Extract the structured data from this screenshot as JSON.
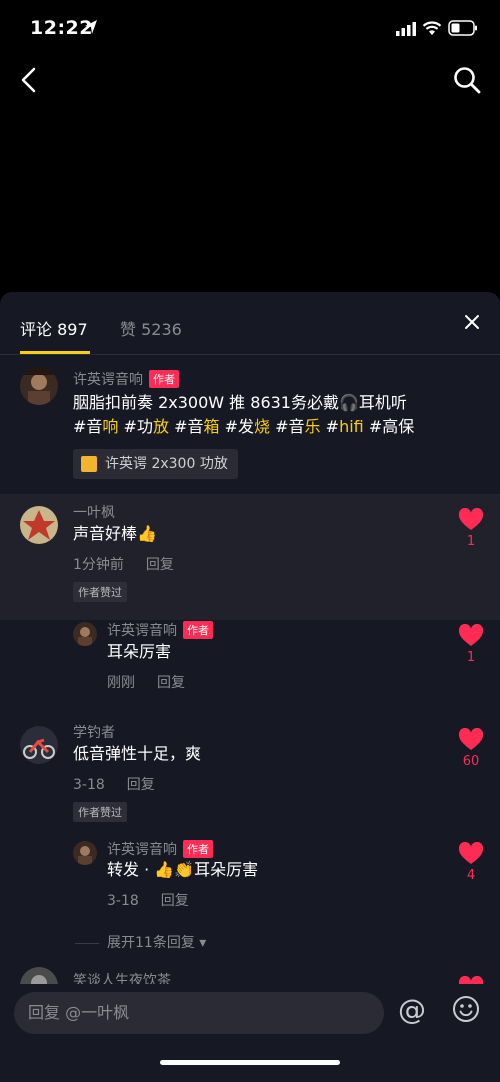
{
  "status_bar": {
    "time": "12:22"
  },
  "tabs": {
    "comments": "评论 897",
    "likes": "赞 5236"
  },
  "pinned": {
    "username": "许英谔音响",
    "author_tag": "作者",
    "text_line1": "胭脂扣前奏 2x300W 推 8631务必戴🎧耳机听",
    "tags": [
      {
        "pre": "#音",
        "hl": "响"
      },
      {
        "pre": "#功",
        "hl": "放"
      },
      {
        "pre": "#音",
        "hl": "箱"
      },
      {
        "pre": "#发",
        "hl": "烧"
      },
      {
        "pre": "#音",
        "hl": "乐"
      },
      {
        "pre": "#",
        "hl": "hifi"
      }
    ],
    "tag_last": "#高保",
    "product": "许英谔 2x300 功放"
  },
  "comments": [
    {
      "username": "一叶枫",
      "text": "声音好棒👍",
      "time": "1分钟前",
      "reply": "回复",
      "liked_by_author": "作者赞过",
      "likes": "1",
      "reply_item": {
        "username": "许英谔音响",
        "author_tag": "作者",
        "text": "耳朵厉害",
        "time": "刚刚",
        "reply": "回复",
        "likes": "1"
      }
    },
    {
      "username": "学钓者",
      "text": "低音弹性十足，爽",
      "time": "3-18",
      "reply": "回复",
      "liked_by_author": "作者赞过",
      "likes": "60",
      "reply_item": {
        "username": "许英谔音响",
        "author_tag": "作者",
        "text": "转发 · 👍👏耳朵厉害",
        "time": "3-18",
        "reply": "回复",
        "likes": "4"
      }
    }
  ],
  "expand_label": "展开11条回复",
  "peek_username": "笑谈人生夜饮茶",
  "input": {
    "placeholder": "回复 @一叶枫"
  },
  "colors": {
    "accent": "#face15",
    "like": "#fe2c55",
    "panel": "#161823"
  }
}
